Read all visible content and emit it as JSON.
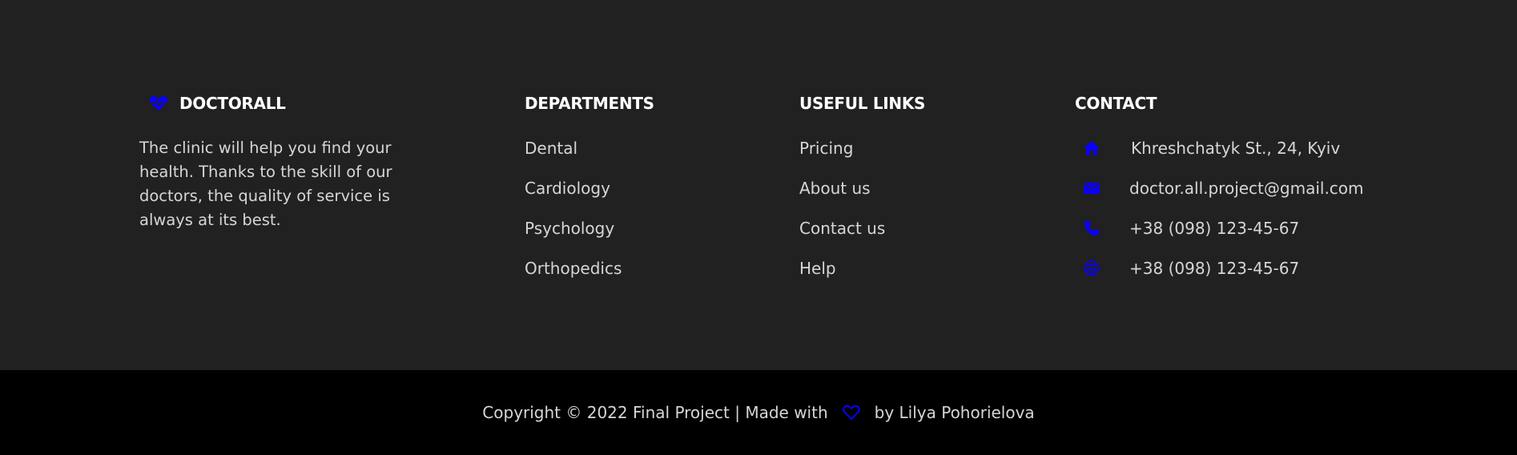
{
  "brand": {
    "name": "DOCTORALL",
    "icon": "heart-pulse-icon",
    "description": "The clinic will help you find your health. Thanks to the skill of our doctors, the quality of service is always at its best."
  },
  "departments": {
    "title": "DEPARTMENTS",
    "items": [
      "Dental",
      "Cardiology",
      "Psychology",
      "Orthopedics"
    ]
  },
  "useful_links": {
    "title": "USEFUL LINKS",
    "items": [
      "Pricing",
      "About us",
      "Contact us",
      "Help"
    ]
  },
  "contact": {
    "title": "CONTACT",
    "address": "Khreshchatyk St., 24, Kyiv",
    "email": "doctor.all.project@gmail.com",
    "phone": "+38 (098) 123-45-67",
    "fax": "+38 (098) 123-45-67"
  },
  "copyright": {
    "prefix": "Copyright © 2022 Final Project | Made with",
    "suffix": "by Lilya Pohorielova"
  },
  "colors": {
    "accent": "#0a00ff",
    "background": "#212121",
    "bottom_bar": "#000000",
    "heading": "#ffffff",
    "text": "#d6d6d6"
  }
}
